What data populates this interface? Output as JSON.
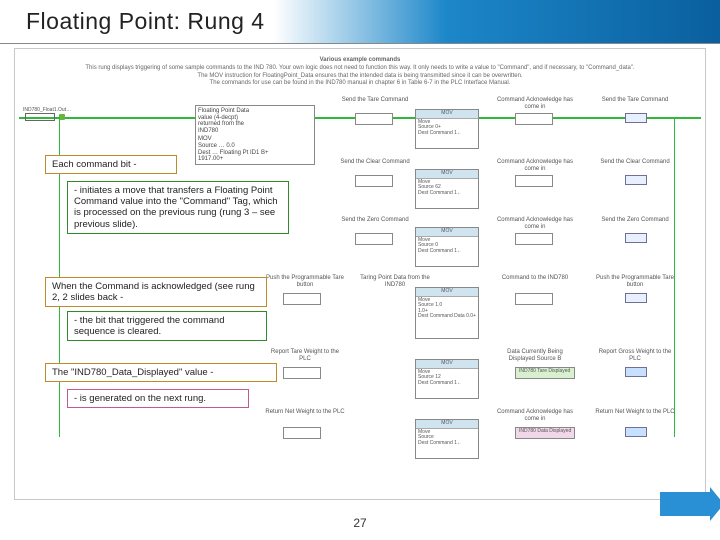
{
  "title": "Floating Point:  Rung 4",
  "page_number": "27",
  "annotations": {
    "a1": "Each command bit -",
    "a2": "- initiates a move that transfers a Floating Point Command value into the \"Command\" Tag, which is processed on the previous rung (rung 3 – see previous slide).",
    "a3": "When the Command is acknowledged (see rung 2, 2 slides back -",
    "a4": "- the bit that triggered the command sequence is cleared.",
    "a5": "The \"IND780_Data_Displayed\" value -",
    "a6": "- is generated on the next rung."
  },
  "bg": {
    "header": "Various example commands",
    "sub1": "This rung displays triggering of some sample commands to the IND 780. Your own logic does not need to function this way. It only needs to write a value to \"Command\", and if necessary, to \"Command_data\".",
    "sub2": "The MOV instruction for FloatingPoint_Data ensures that the intended data is being transmitted since it can be overwritten.",
    "sub3": "The commands for use can be found in the IND780 manual in chapter 6 in Table 6-7 in the PLC Interface Manual.",
    "fp_box": [
      "Floating Point Data",
      "value (4-decpt)",
      "returned from the",
      "IND780"
    ],
    "cap_send_tare": "Send the Tare Command",
    "cap_send_clear": "Send the Clear Command",
    "cap_send_zero": "Send the Zero Command",
    "cap_cmd_to": "Command to the IND780",
    "cap_cmd_ack": "Command Acknowledge has come in",
    "cap_store_prog": "Push the Programmable Tare button",
    "cap_tare_fp": "Taring Point Data from the IND780",
    "cap_cmd_data": "Dest  Command Data 0.0+",
    "cap_disp_tare": "Report Tare Weight to the PLC",
    "cap_data_curr": "Data Currently Being Displayed Source B",
    "cap_rep_gross": "Report Gross Weight to the PLC",
    "cap_ret_net": "Return Net Weight to the PLC",
    "cap_ind_disp": "IND780 Data Displayed",
    "cap_ind_tare_disp": "IND780 Tare Displayed",
    "mov_label": "MOV",
    "mov_move": "Move",
    "mov_src": "Source",
    "mov_dest": "Dest",
    "mov_cmd": "Command",
    "tag_prefix": "IND780_Float_"
  }
}
